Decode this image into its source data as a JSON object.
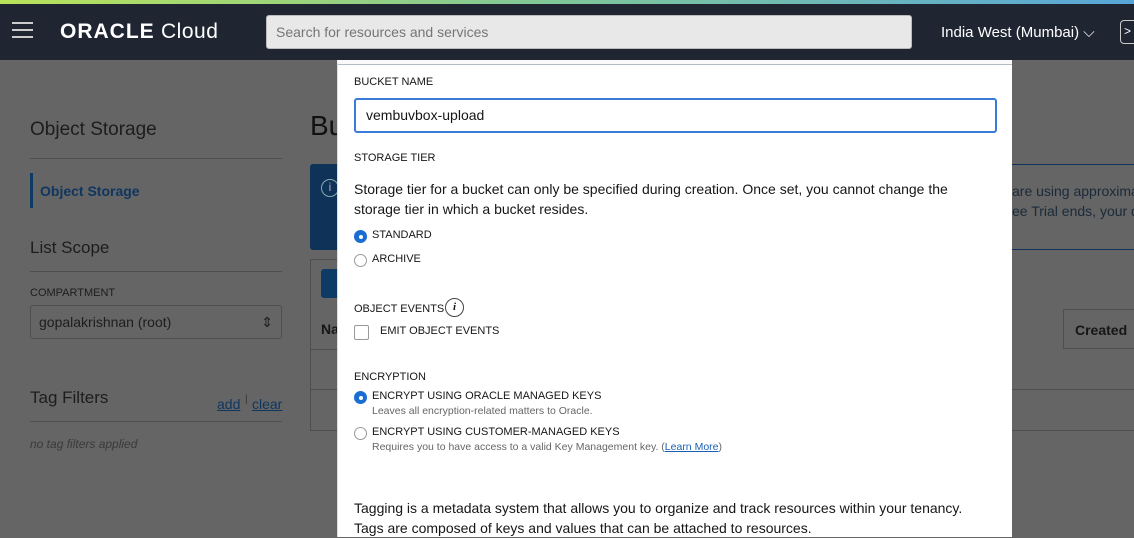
{
  "header": {
    "logo_bold": "ORACLE",
    "logo_light": "Cloud",
    "search_placeholder": "Search for resources and services",
    "region": "India West (Mumbai)"
  },
  "sidebar": {
    "title": "Object Storage",
    "active_item": "Object Storage",
    "list_scope": "List Scope",
    "compartment_label": "COMPARTMENT",
    "compartment_value": "gopalakrishnan (root)",
    "tag_filters": "Tag Filters",
    "add": "add",
    "clear": "clear",
    "no_tags": "no tag filters applied"
  },
  "background": {
    "page_title": "Bu",
    "notice_line1": "are using approxima",
    "notice_line2": "ee Trial ends, your d",
    "col_name": "Na",
    "col_created": "Created"
  },
  "modal": {
    "bucket_name_label": "BUCKET NAME",
    "bucket_name_value": "vembuvbox-upload",
    "storage_tier_label": "STORAGE TIER",
    "storage_tier_text": "Storage tier for a bucket can only be specified during creation. Once set, you cannot change the storage tier in which a bucket resides.",
    "tier_standard": "STANDARD",
    "tier_archive": "ARCHIVE",
    "selected_tier": "STANDARD",
    "object_events_label": "OBJECT EVENTS",
    "emit_events": "EMIT OBJECT EVENTS",
    "emit_events_checked": false,
    "encryption_label": "ENCRYPTION",
    "enc_oracle": "ENCRYPT USING ORACLE MANAGED KEYS",
    "enc_oracle_desc": "Leaves all encryption-related matters to Oracle.",
    "enc_customer": "ENCRYPT USING CUSTOMER-MANAGED KEYS",
    "enc_customer_desc": "Requires you to have access to a valid Key Management key. (",
    "learn_more": "Learn More",
    "enc_customer_desc_end": ")",
    "tagging_text": "Tagging is a metadata system that allows you to organize and track resources within your tenancy. Tags are composed of keys and values that can be attached to resources."
  },
  "colors": {
    "accent": "#1a6ed1",
    "header": "#1f2632"
  }
}
